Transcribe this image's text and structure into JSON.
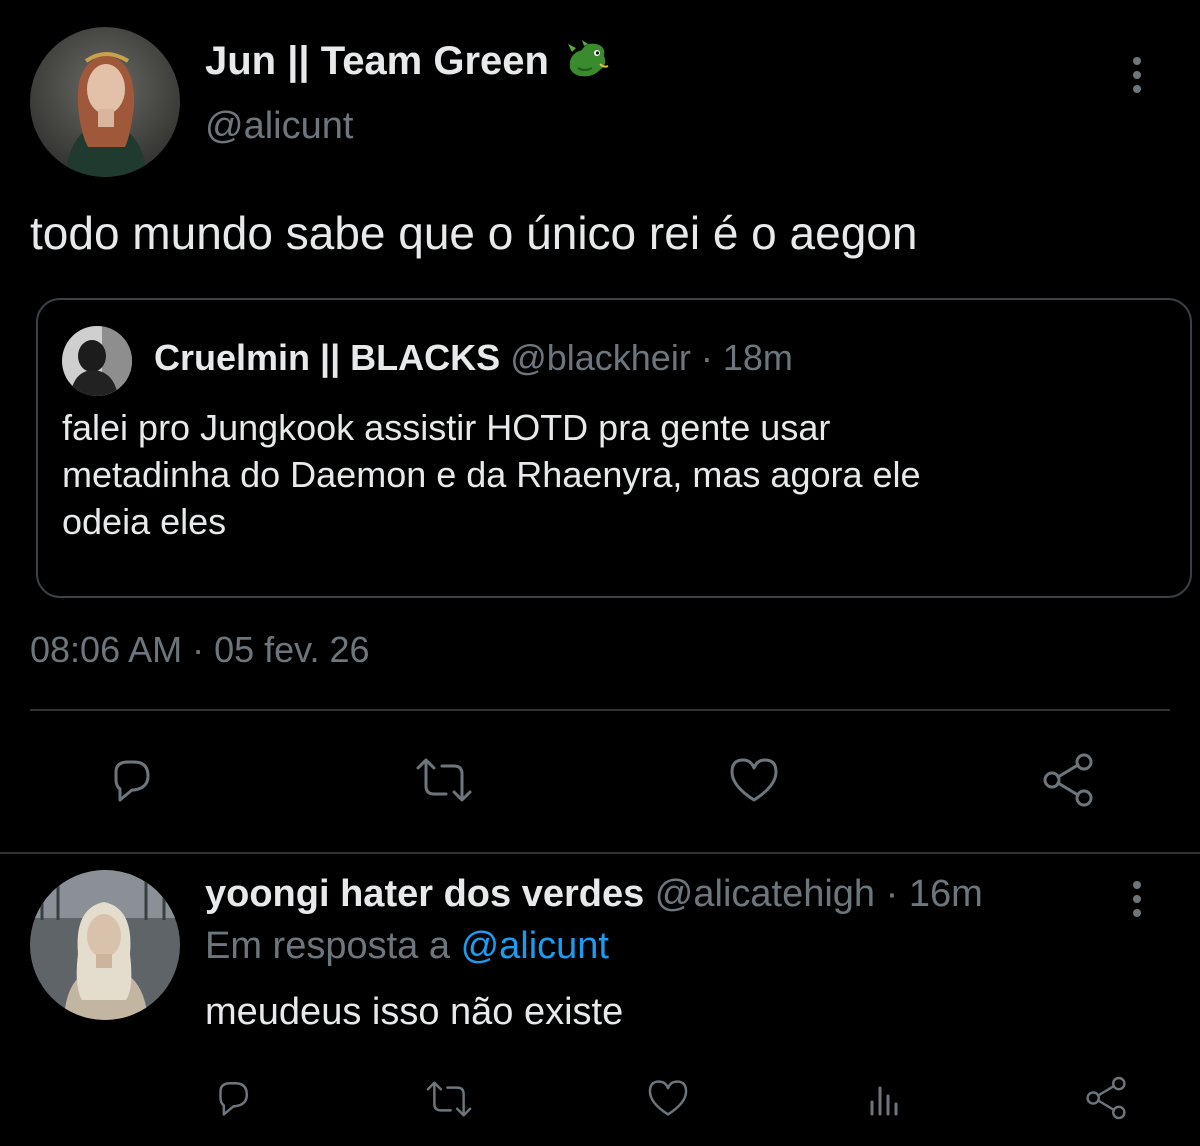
{
  "main_tweet": {
    "author_name": "Jun || Team Green",
    "author_badge": "dragon-emoji",
    "author_handle": "@alicunt",
    "text": "todo mundo sabe que o único rei é o aegon",
    "timestamp": "08:06 AM · 05 fev. 26",
    "quoted": {
      "author_name": "Cruelmin || BLACKS",
      "author_handle": "@blackheir",
      "separator": "·",
      "time": "18m",
      "text_lines": [
        "falei pro Jungkook assistir HOTD pra gente usar",
        "metadinha do Daemon e da Rhaenyra, mas agora ele",
        "odeia eles"
      ]
    },
    "actions": [
      "reply-icon",
      "retweet-icon",
      "like-icon",
      "share-icon"
    ]
  },
  "reply": {
    "author_name": "yoongi hater dos verdes",
    "author_handle": "@alicatehigh",
    "separator": "·",
    "time": "16m",
    "reply_prefix": "Em resposta a",
    "reply_to": "@alicunt",
    "text": "meudeus isso não existe",
    "actions": [
      "reply-icon",
      "retweet-icon",
      "like-icon",
      "analytics-icon",
      "share-icon"
    ]
  },
  "colors": {
    "background": "#000000",
    "text": "#e7e9ea",
    "muted": "#6e767d",
    "link": "#1d9bf0",
    "divider": "#2f3336"
  }
}
